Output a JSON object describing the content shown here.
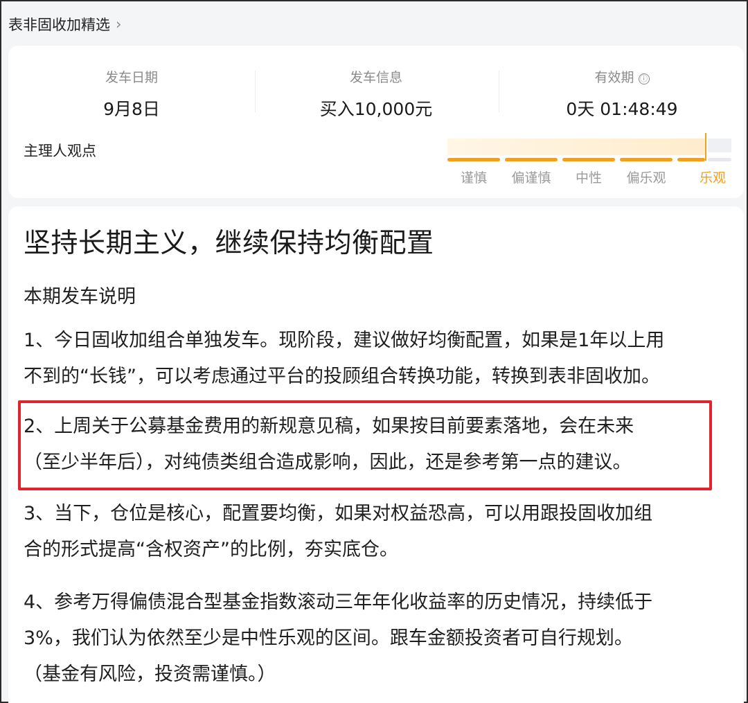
{
  "header": {
    "title": "表非固收加精选",
    "chevron": "›"
  },
  "stats": {
    "depart_date": {
      "label": "发车日期",
      "value": "9月8日"
    },
    "depart_info": {
      "label": "发车信息",
      "value": "买入10,000元"
    },
    "validity": {
      "label": "有效期",
      "info_icon": "ⓘ",
      "value": "0天 01:48:49"
    }
  },
  "manager_view": {
    "label": "主理人观点",
    "scale": [
      "谨慎",
      "偏谨慎",
      "中性",
      "偏乐观",
      "乐观"
    ],
    "selected": "乐观",
    "accent_color": "#f0a020"
  },
  "article": {
    "headline": "坚持长期主义，继续保持均衡配置",
    "subtitle": "本期发车说明",
    "p1_line1": "1、今日固收加组合单独发车。现阶段，建议做好均衡配置，如果是1年以上用",
    "p1_line2": "不到的“长钱”，可以考虑通过平台的投顾组合转换功能，转换到表非固收加。",
    "p2_line1": "2、上周关于公募基金费用的新规意见稿，如果按目前要素落地，会在未来",
    "p2_line2": "（至少半年后），对纯债类组合造成影响，因此，还是参考第一点的建议。",
    "p3_line1": "3、当下，仓位是核心，配置要均衡，如果对权益恐高，可以用跟投固收加组",
    "p3_line2": "合的形式提高“含权资产”的比例，夯实底仓。",
    "p4_line1": "4、参考万得偏债混合型基金指数滚动三年年化收益率的历史情况，持续低于",
    "p4_line2": "3%，我们认为依然至少是中性乐观的区间。跟车金额投资者可自行规划。",
    "p4_line3": "（基金有风险，投资需谨慎。）",
    "highlight_color": "#e0242b"
  }
}
